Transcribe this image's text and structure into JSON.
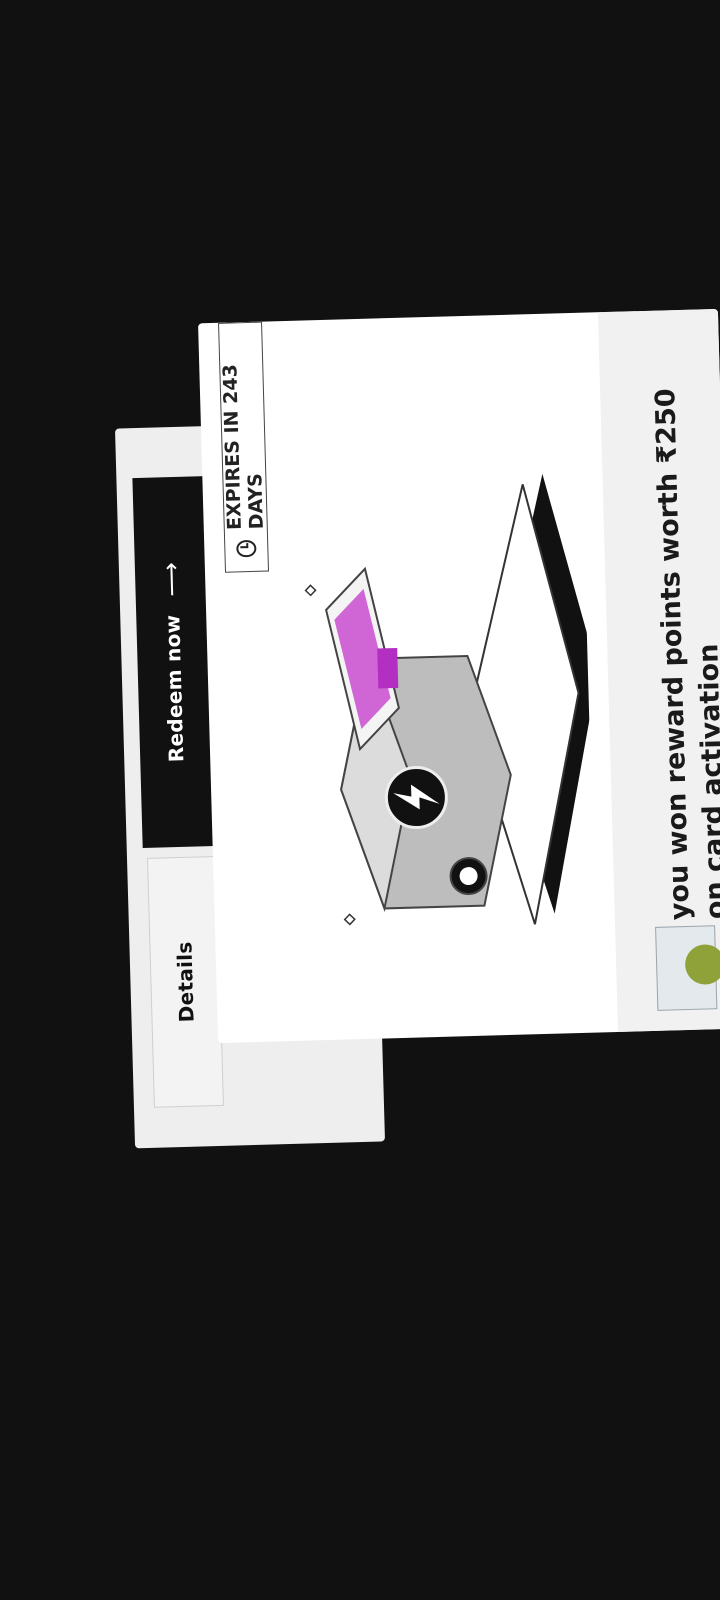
{
  "actions": {
    "details_label": "Details",
    "redeem_label": "Redeem now",
    "redeem_arrow": "⟶"
  },
  "reward": {
    "expiry": "EXPIRES IN 243 DAYS",
    "title_line1": "you won reward points worth ₹250",
    "title_line2": "on card activation"
  },
  "colors": {
    "background": "#111111",
    "accent": "#c94ccf",
    "coin": "#8fa23a"
  }
}
